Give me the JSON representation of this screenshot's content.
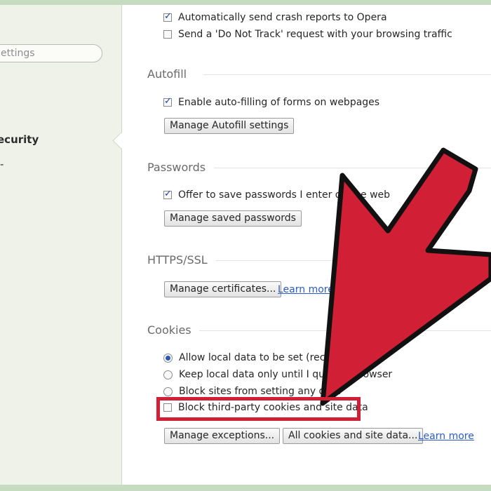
{
  "sidebar": {
    "search_placeholder": "ettings",
    "active_item": "ecurity",
    "next_item_fragment": "-"
  },
  "privacy": {
    "crash_reports_label": "Automatically send crash reports to Opera",
    "crash_reports_checked": true,
    "do_not_track_label": "Send a 'Do Not Track' request with your browsing traffic",
    "do_not_track_checked": false
  },
  "autofill": {
    "title": "Autofill",
    "enable_label": "Enable auto-filling of forms on webpages",
    "enable_checked": true,
    "manage_button": "Manage Autofill settings"
  },
  "passwords": {
    "title": "Passwords",
    "offer_label": "Offer to save passwords I enter on the web",
    "offer_checked": true,
    "manage_button": "Manage saved passwords"
  },
  "https": {
    "title": "HTTPS/SSL",
    "certificates_button": "Manage certificates...",
    "learn_more": "Learn more"
  },
  "cookies": {
    "title": "Cookies",
    "options": [
      {
        "label": "Allow local data to be set (recommended)",
        "selected": true
      },
      {
        "label": "Keep local data only until I quit my browser",
        "selected": false
      },
      {
        "label": "Block sites from setting any data",
        "selected": false
      }
    ],
    "block_third_party_label": "Block third-party cookies and site data",
    "block_third_party_checked": false,
    "exceptions_button": "Manage exceptions...",
    "all_cookies_button": "All cookies and site data...",
    "learn_more": "Learn more"
  },
  "colors": {
    "annotation_red": "#d11f35",
    "link_blue": "#2b5cc8",
    "checkbox_blue": "#1e3f9c",
    "sidebar_bg": "#eef2e9"
  }
}
